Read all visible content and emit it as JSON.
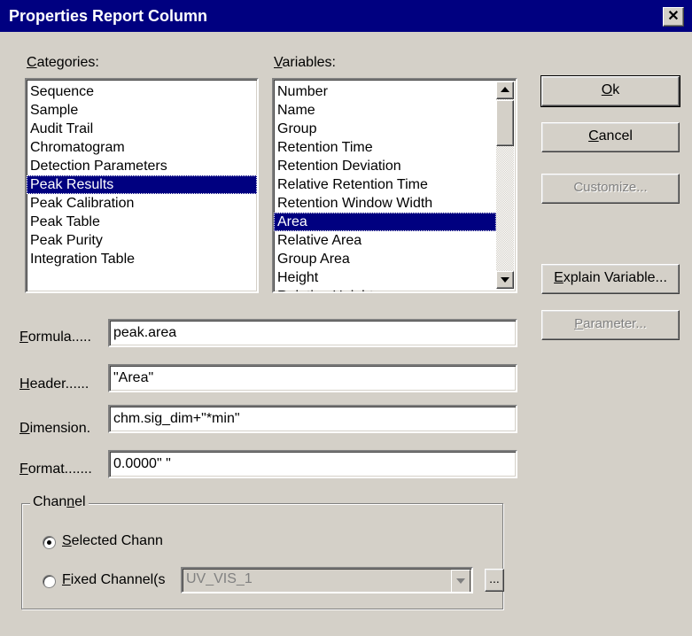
{
  "window": {
    "title": "Properties Report Column",
    "close_glyph": "✕"
  },
  "categories": {
    "label": "Categories:",
    "items": [
      "Sequence",
      "Sample",
      "Audit Trail",
      "Chromatogram",
      "Detection Parameters",
      "Peak Results",
      "Peak Calibration",
      "Peak Table",
      "Peak Purity",
      "Integration Table"
    ],
    "selected": "Peak Results"
  },
  "variables": {
    "label": "Variables:",
    "items": [
      "Number",
      "Name",
      "Group",
      "Retention Time",
      "Retention Deviation",
      "Relative Retention Time",
      "Retention Window Width",
      "Area",
      "Relative Area",
      "Group Area",
      "Height",
      "Relative Height"
    ],
    "selected": "Area"
  },
  "buttons": {
    "ok": "Ok",
    "cancel": "Cancel",
    "customize": "Customize...",
    "explain": "Explain Variable...",
    "parameter": "Parameter..."
  },
  "fields": {
    "formula": {
      "label": "Formula.....",
      "value": "peak.area"
    },
    "header": {
      "label": "Header......",
      "value": "\"Area\""
    },
    "dimension": {
      "label": "Dimension.",
      "value": "chm.sig_dim+\"*min\""
    },
    "format": {
      "label": "Format.......",
      "value": "0.0000\"  \""
    }
  },
  "channel": {
    "label": "Channel",
    "selected_label": "Selected Chann",
    "fixed_label": "Fixed Channel(s",
    "fixed_value": "UV_VIS_1",
    "browse": "...",
    "selected_option": "selected"
  },
  "colors": {
    "face": "#d4d0c8",
    "title": "#000080",
    "highlight": "#000080"
  }
}
